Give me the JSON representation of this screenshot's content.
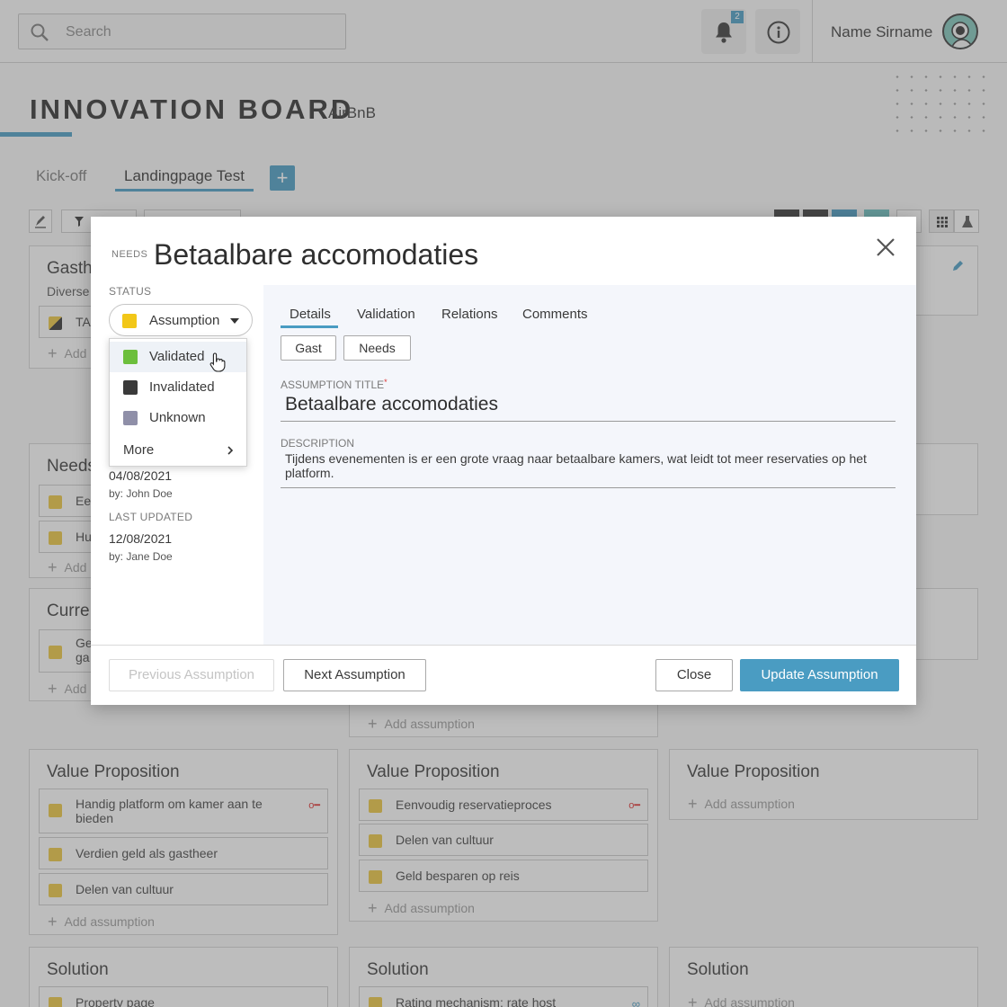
{
  "topbar": {
    "search_placeholder": "Search",
    "notification_count": "2",
    "user_name": "Name Sirname",
    "icons": [
      "search-icon",
      "bell-icon",
      "info-icon",
      "avatar"
    ]
  },
  "board": {
    "title": "INNOVATION BOARD",
    "subtitle": "AirBnB",
    "tabs": [
      {
        "label": "Kick-off"
      },
      {
        "label": "Landingpage Test"
      }
    ],
    "add_tab_label": "+"
  },
  "columns": {
    "gastheer": {
      "title": "Gasth",
      "subtitle": "Diverse",
      "items": [
        "TA"
      ],
      "add": "Add"
    },
    "needs": {
      "title": "Needs",
      "items": [
        "Ee",
        "Hu"
      ],
      "add": "Add"
    },
    "current": {
      "title": "Curre",
      "items": [
        "Ge ga"
      ],
      "add": "Add"
    },
    "col2_add": "Add assumption",
    "value_proposition": [
      {
        "title": "Value Proposition",
        "items": [
          "Handig platform om kamer aan te bieden",
          "Verdien geld als gastheer",
          "Delen van cultuur"
        ],
        "add": "Add assumption"
      },
      {
        "title": "Value Proposition",
        "items": [
          "Eenvoudig reservatieproces",
          "Delen van cultuur",
          "Geld besparen op reis"
        ],
        "add": "Add assumption"
      },
      {
        "title": "Value Proposition",
        "items": [],
        "add": "Add assumption"
      }
    ],
    "solution": [
      {
        "title": "Solution",
        "items": [
          "Property page"
        ]
      },
      {
        "title": "Solution",
        "items": [
          "Rating mechanism: rate host"
        ]
      },
      {
        "title": "Solution",
        "items": [],
        "add": "Add assumption"
      }
    ]
  },
  "modal": {
    "category": "NEEDS",
    "title": "Betaalbare accomodaties",
    "status_label": "STATUS",
    "status_value": "Assumption",
    "status_options": [
      {
        "label": "Validated",
        "color": "#6cbf3c"
      },
      {
        "label": "Invalidated",
        "color": "#3a3a3a"
      },
      {
        "label": "Unknown",
        "color": "#8f8fa8"
      }
    ],
    "more_label": "More",
    "created_date": "04/08/2021",
    "created_by": "by: John Doe",
    "last_updated_label": "LAST UPDATED",
    "updated_date": "12/08/2021",
    "updated_by": "by: Jane Doe",
    "tabs": [
      "Details",
      "Validation",
      "Relations",
      "Comments"
    ],
    "chips": [
      "Gast",
      "Needs"
    ],
    "assumption_title_label": "ASSUMPTION TITLE",
    "required_mark": "*",
    "assumption_title_value": "Betaalbare accomodaties",
    "description_label": "DESCRIPTION",
    "description_value": "Tijdens evenementen is er een grote vraag naar betaalbare kamers, wat leidt tot meer reservaties op het platform.",
    "buttons": {
      "previous": "Previous Assumption",
      "next": "Next Assumption",
      "close": "Close",
      "update": "Update Assumption"
    }
  },
  "colors": {
    "accent": "#4a9cc2",
    "assumption_yellow": "#f2c718",
    "item_yellow": "#e9c43f"
  }
}
